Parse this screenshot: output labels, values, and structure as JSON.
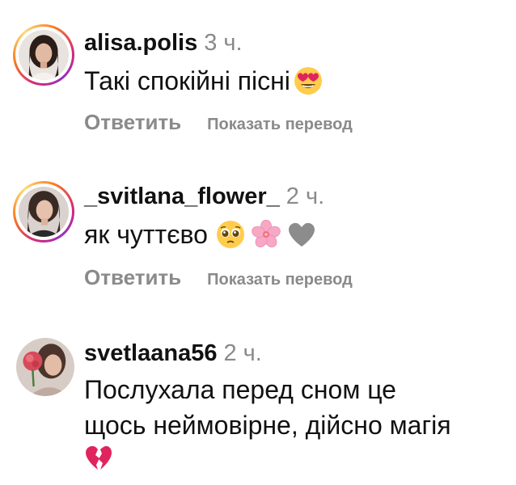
{
  "comments": [
    {
      "username": "alisa.polis",
      "time": "3 ч.",
      "text": "Такі спокійні пісні",
      "emojis": [
        "heart-eyes-emoji"
      ],
      "reply_label": "Ответить",
      "translate_label": "Показать перевод",
      "has_story_ring": true
    },
    {
      "username": "_svitlana_flower_",
      "time": "2 ч.",
      "text": "як чуттєво",
      "emojis": [
        "pleading-face-emoji",
        "cherry-blossom-emoji",
        "grey-heart-emoji"
      ],
      "reply_label": "Ответить",
      "translate_label": "Показать перевод",
      "has_story_ring": true
    },
    {
      "username": "svetlaana56",
      "time": "2 ч.",
      "text_lines": [
        "Послухала перед сном це",
        "щось неймовірне, дійсно магія"
      ],
      "emojis": [
        "broken-heart-emoji"
      ],
      "has_story_ring": false
    }
  ],
  "colors": {
    "text": "#111111",
    "secondary": "#8a8a8a",
    "story_ring_start": "#d62976",
    "story_ring_end": "#fa7e1e",
    "broken_heart": "#e0245e"
  }
}
